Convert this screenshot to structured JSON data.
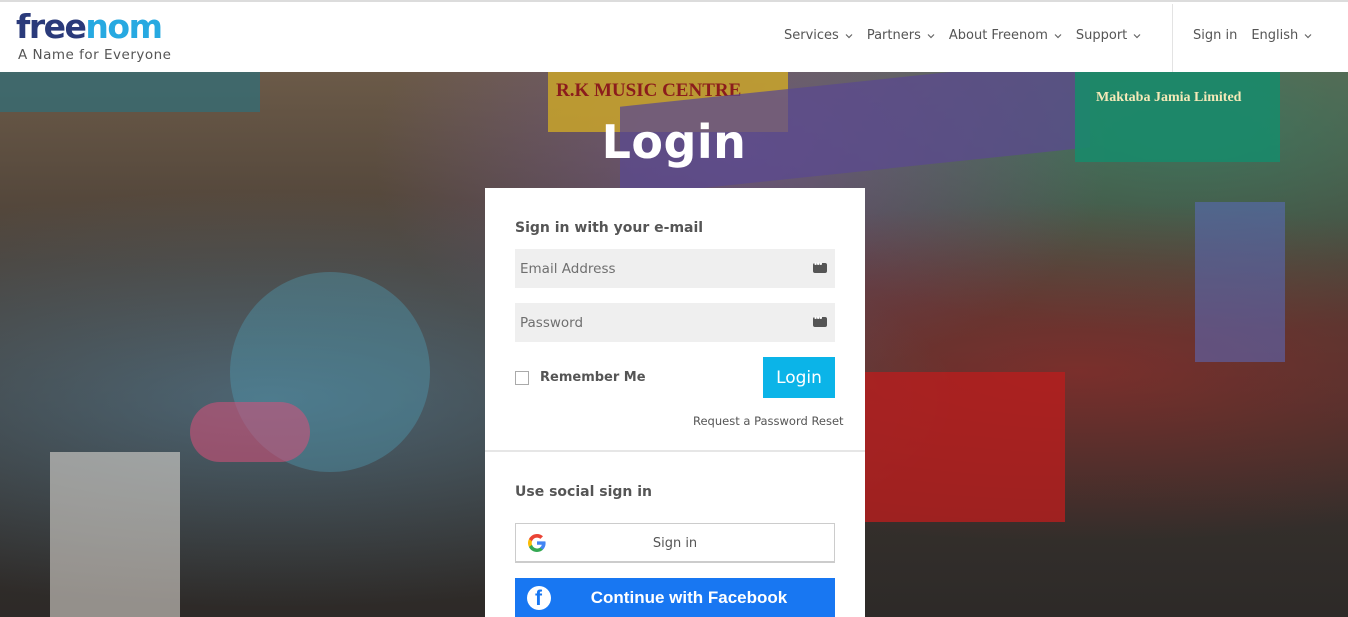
{
  "header": {
    "logo": {
      "part1": "free",
      "part2": "nom"
    },
    "tagline": "A Name for Everyone",
    "nav": [
      {
        "label": "Services"
      },
      {
        "label": "Partners"
      },
      {
        "label": "About Freenom"
      },
      {
        "label": "Support"
      }
    ],
    "sign_in": "Sign in",
    "language": "English"
  },
  "hero": {
    "title": "Login",
    "storefront_signs": [
      "R.K MUSIC CENTRE",
      "Maktaba Jamia Limited"
    ]
  },
  "login_card": {
    "email_heading": "Sign in with your e-mail",
    "email_placeholder": "Email Address",
    "password_placeholder": "Password",
    "remember_label": "Remember Me",
    "login_button": "Login",
    "reset_link": "Request a Password Reset",
    "social_heading": "Use social sign in",
    "google_button": "Sign in",
    "facebook_button": "Continue with Facebook"
  },
  "colors": {
    "brand_dark": "#2a3a7a",
    "brand_accent": "#27a9e1",
    "login_button": "#0bb4e8",
    "facebook": "#1877f2"
  },
  "icons": {
    "nav": "chevron-down-icon",
    "field": "keyboard-icon",
    "google": "google-icon",
    "facebook": "facebook-icon"
  }
}
